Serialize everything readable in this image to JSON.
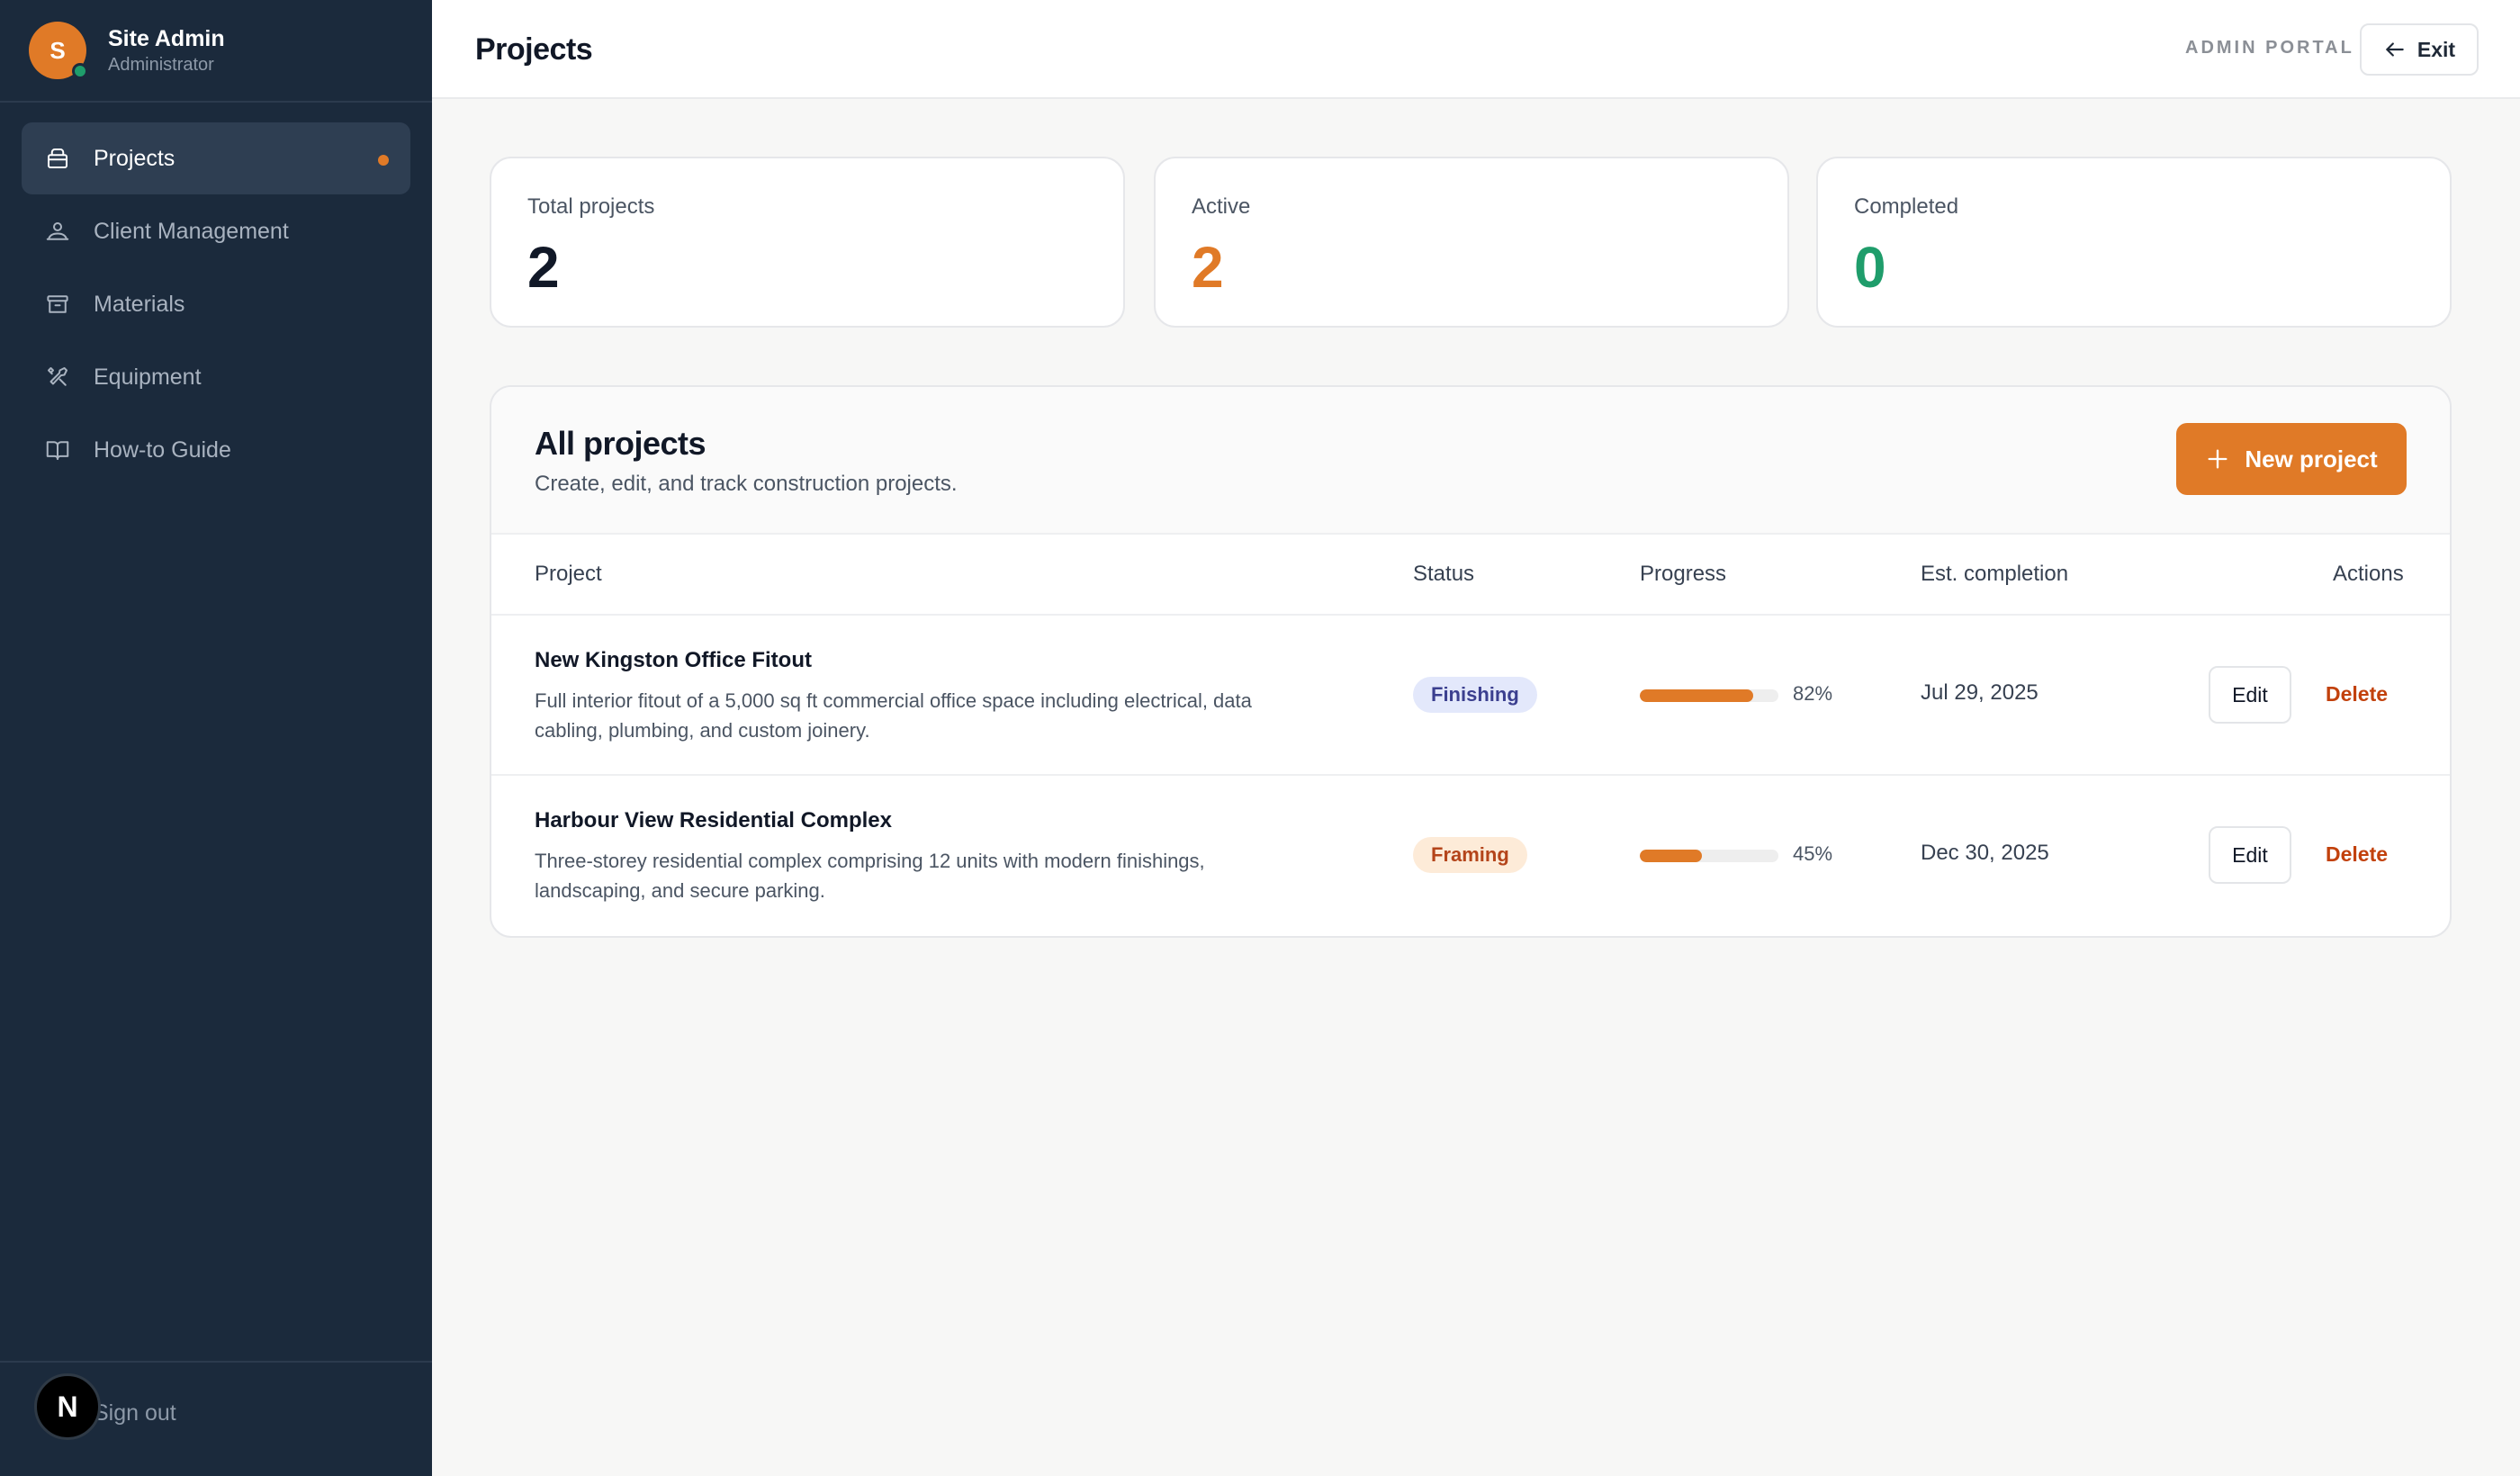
{
  "user": {
    "initial": "S",
    "name": "Site Admin",
    "role": "Administrator"
  },
  "sidebar": {
    "items": [
      {
        "label": "Projects",
        "icon": "briefcase-icon",
        "active": true
      },
      {
        "label": "Client Management",
        "icon": "users-icon"
      },
      {
        "label": "Materials",
        "icon": "archive-box-icon"
      },
      {
        "label": "Equipment",
        "icon": "tools-icon"
      },
      {
        "label": "How-to Guide",
        "icon": "book-icon"
      }
    ],
    "sign_out": "Sign out",
    "badge_letter": "N"
  },
  "header": {
    "title": "Projects",
    "portal_label": "ADMIN PORTAL",
    "exit_label": "Exit"
  },
  "stats": [
    {
      "label": "Total projects",
      "value": "2",
      "color": "#111827"
    },
    {
      "label": "Active",
      "value": "2",
      "color": "#e07a27"
    },
    {
      "label": "Completed",
      "value": "0",
      "color": "#1f9d6b"
    }
  ],
  "projects_panel": {
    "title": "All projects",
    "subtitle": "Create, edit, and track construction projects.",
    "new_button": "New project",
    "columns": [
      "Project",
      "Status",
      "Progress",
      "Est. completion",
      "Actions"
    ],
    "rows": [
      {
        "name": "New Kingston Office Fitout",
        "description": "Full interior fitout of a 5,000 sq ft commercial office space including electrical, data cabling, plumbing, and custom joinery.",
        "status": "Finishing",
        "status_bg": "#e3e8fb",
        "status_color": "#3b3f8f",
        "progress": 82,
        "progress_label": "82%",
        "est_completion": "Jul 29, 2025",
        "edit": "Edit",
        "delete": "Delete"
      },
      {
        "name": "Harbour View Residential Complex",
        "description": "Three-storey residential complex comprising 12 units with modern finishings, landscaping, and secure parking.",
        "status": "Framing",
        "status_bg": "#fdebd8",
        "status_color": "#b4441a",
        "progress": 45,
        "progress_label": "45%",
        "est_completion": "Dec 30, 2025",
        "edit": "Edit",
        "delete": "Delete"
      }
    ]
  },
  "colors": {
    "accent": "#e07a27",
    "sidebar_bg": "#1b2a3c",
    "success": "#1f9d6b",
    "danger": "#c2410c"
  }
}
